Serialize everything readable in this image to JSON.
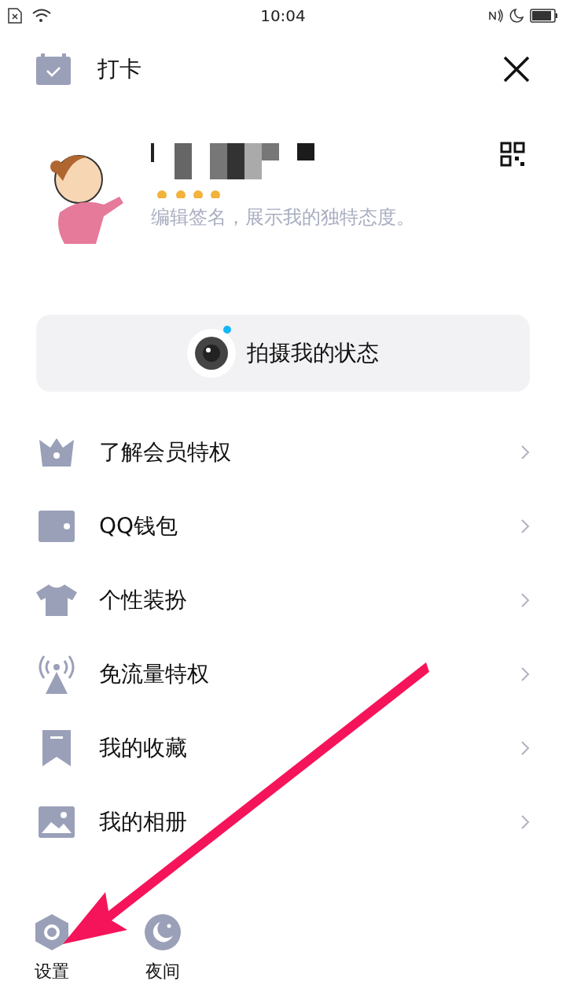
{
  "status_bar": {
    "time": "10:04"
  },
  "header": {
    "title": "打卡"
  },
  "profile": {
    "signature": "编辑签名，展示我的独特态度。"
  },
  "status_button": {
    "label": "拍摄我的状态",
    "unread": true
  },
  "menu": [
    {
      "kind": "crown",
      "label": "了解会员特权"
    },
    {
      "kind": "wallet",
      "label": "QQ钱包"
    },
    {
      "kind": "shirt",
      "label": "个性装扮"
    },
    {
      "kind": "antenna",
      "label": "免流量特权"
    },
    {
      "kind": "bookmark",
      "label": "我的收藏"
    },
    {
      "kind": "image",
      "label": "我的相册"
    }
  ],
  "bottom": [
    {
      "kind": "settings",
      "label": "设置"
    },
    {
      "kind": "night",
      "label": "夜间"
    }
  ]
}
